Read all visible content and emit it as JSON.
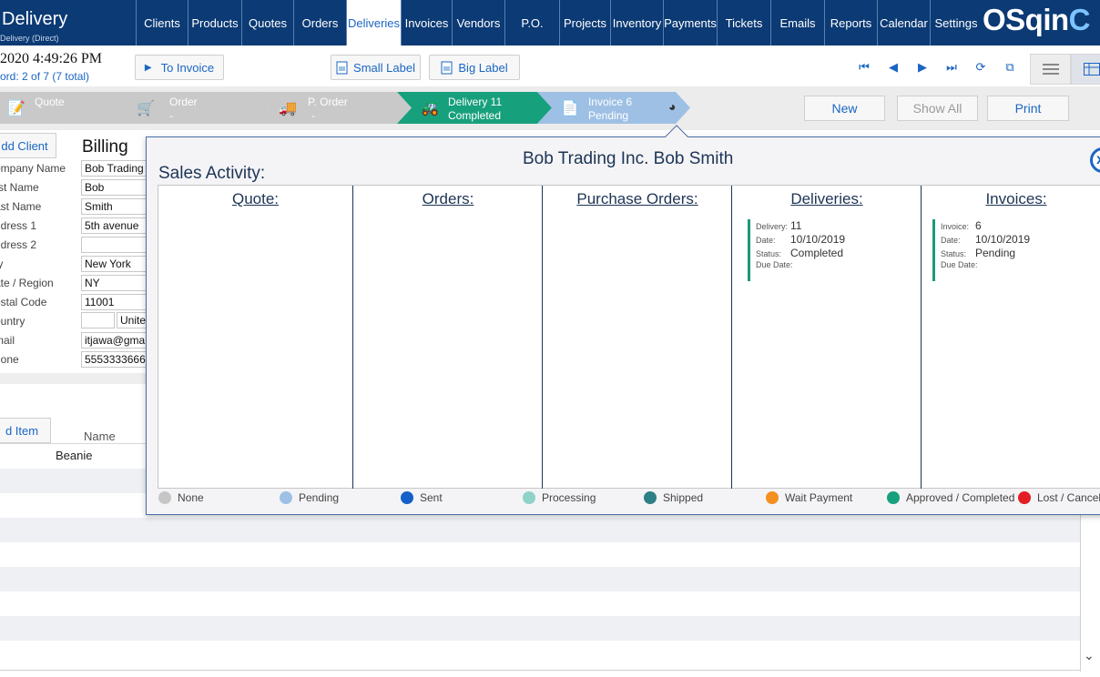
{
  "app": {
    "title": "Delivery",
    "subtitle": "Delivery (Direct)"
  },
  "nav": {
    "items": [
      {
        "label": "Clients"
      },
      {
        "label": "Products"
      },
      {
        "label": "Quotes"
      },
      {
        "label": "Orders"
      },
      {
        "label": "Deliveries"
      },
      {
        "label": "Invoices"
      },
      {
        "label": "Vendors"
      },
      {
        "label": "P.O."
      },
      {
        "label": "Projects"
      },
      {
        "label": "Inventory"
      },
      {
        "label": "Payments"
      },
      {
        "label": "Tickets"
      },
      {
        "label": "Emails"
      },
      {
        "label": "Reports"
      },
      {
        "label": "Calendar"
      },
      {
        "label": "Settings"
      }
    ],
    "active": "Deliveries",
    "logo_main": "OSqin",
    "logo_accent": "C"
  },
  "header": {
    "datetime": "2020 4:49:26 PM",
    "record": "ord:  2 of 7 (7 total)",
    "to_invoice": "To Invoice",
    "small_label": "Small Label",
    "big_label": "Big Label"
  },
  "workflow": {
    "steps": [
      {
        "line1": "Quote",
        "line2": "",
        "color": "#c9c9c9"
      },
      {
        "line1": "Order",
        "line2": "-",
        "color": "#c9c9c9"
      },
      {
        "line1": "P. Order",
        "line2": "-",
        "color": "#c9c9c9"
      },
      {
        "line1": "Delivery 11",
        "line2": "Completed",
        "color": "#17a07c"
      },
      {
        "line1": "Invoice 6",
        "line2": "Pending",
        "color": "#9ec0e4"
      }
    ]
  },
  "actions": {
    "new": "New",
    "show_all": "Show All",
    "print": "Print"
  },
  "form": {
    "add_client": "dd Client",
    "billing": "Billing",
    "fields": [
      {
        "label": "ompany Name",
        "value": "Bob Trading"
      },
      {
        "label": "rst Name",
        "value": "Bob"
      },
      {
        "label": "ast Name",
        "value": "Smith"
      },
      {
        "label": "ddress 1",
        "value": "5th avenue"
      },
      {
        "label": "ddress 2",
        "value": ""
      },
      {
        "label": "ty",
        "value": "New York"
      },
      {
        "label": "ate / Region",
        "value": "NY"
      },
      {
        "label": "ostal Code",
        "value": "11001"
      },
      {
        "label": "ountry",
        "value": "",
        "value2": "Unite"
      },
      {
        "label": "mail",
        "value": "itjawa@gma"
      },
      {
        "label": "hone",
        "value": "5553333666"
      }
    ],
    "add_item": "d Item",
    "col_name": "Name",
    "item": "Beanie"
  },
  "panel": {
    "title": "Sales Activity:",
    "client": "Bob Trading Inc.   Bob Smith",
    "close": "x",
    "columns": [
      {
        "title": "Quote:"
      },
      {
        "title": "Orders:"
      },
      {
        "title": "Purchase Orders:"
      },
      {
        "title": "Deliveries:"
      },
      {
        "title": "Invoices:"
      }
    ],
    "delivery": {
      "lbl_no": "Delivery:",
      "no": "11",
      "lbl_date": "Date:",
      "date": "10/10/2019",
      "lbl_status": "Status:",
      "status": "Completed",
      "lbl_due": "Due Date:"
    },
    "invoice": {
      "lbl_no": "Invoice:",
      "no": "6",
      "lbl_date": "Date:",
      "date": "10/10/2019",
      "lbl_status": "Status:",
      "status": "Pending",
      "lbl_due": "Due Date:"
    },
    "legend": [
      {
        "label": "None",
        "color": "#c6c6c6"
      },
      {
        "label": "Pending",
        "color": "#9ec0e4"
      },
      {
        "label": "Sent",
        "color": "#1560c8"
      },
      {
        "label": "Processing",
        "color": "#8fd3c8"
      },
      {
        "label": "Shipped",
        "color": "#2e7f86"
      },
      {
        "label": "Wait Payment",
        "color": "#f39020"
      },
      {
        "label": "Approved / Completed",
        "color": "#17a07c"
      },
      {
        "label": "Lost / Cancel",
        "color": "#e31e24"
      }
    ]
  }
}
